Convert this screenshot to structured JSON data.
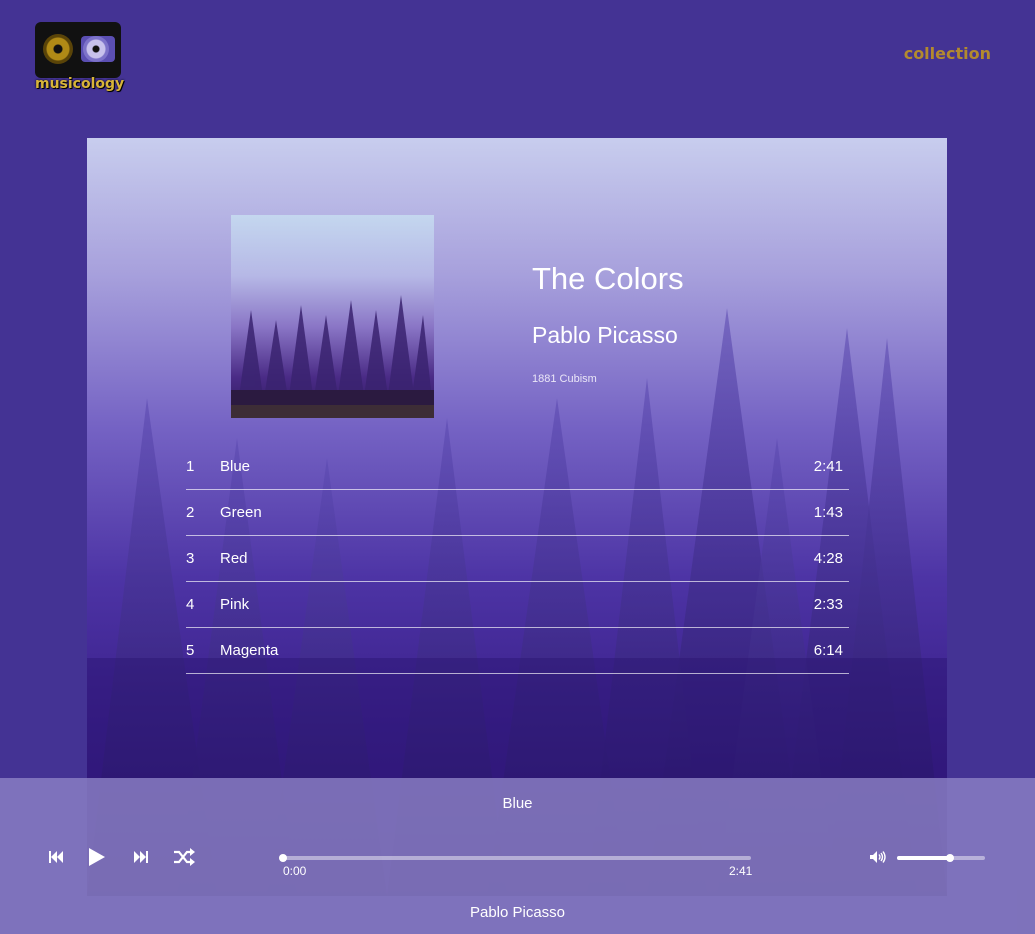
{
  "header": {
    "logo_text": "musicology",
    "nav_link": "collection"
  },
  "album": {
    "title": "The Colors",
    "artist": "Pablo Picasso",
    "meta": "1881 Cubism"
  },
  "tracks": [
    {
      "number": "1",
      "title": "Blue",
      "duration": "2:41"
    },
    {
      "number": "2",
      "title": "Green",
      "duration": "1:43"
    },
    {
      "number": "3",
      "title": "Red",
      "duration": "4:28"
    },
    {
      "number": "4",
      "title": "Pink",
      "duration": "2:33"
    },
    {
      "number": "5",
      "title": "Magenta",
      "duration": "6:14"
    }
  ],
  "player": {
    "current_title": "Blue",
    "current_artist": "Pablo Picasso",
    "time_current": "0:00",
    "time_total": "2:41",
    "progress": 0.0,
    "volume": 0.6,
    "icons": {
      "prev": "skip-previous-icon",
      "play": "play-icon",
      "next": "skip-next-icon",
      "shuffle": "shuffle-icon",
      "volume": "volume-icon"
    }
  },
  "colors": {
    "background": "#443394",
    "nav_link": "#b38a2e",
    "player_bar": "#8b80c4"
  }
}
